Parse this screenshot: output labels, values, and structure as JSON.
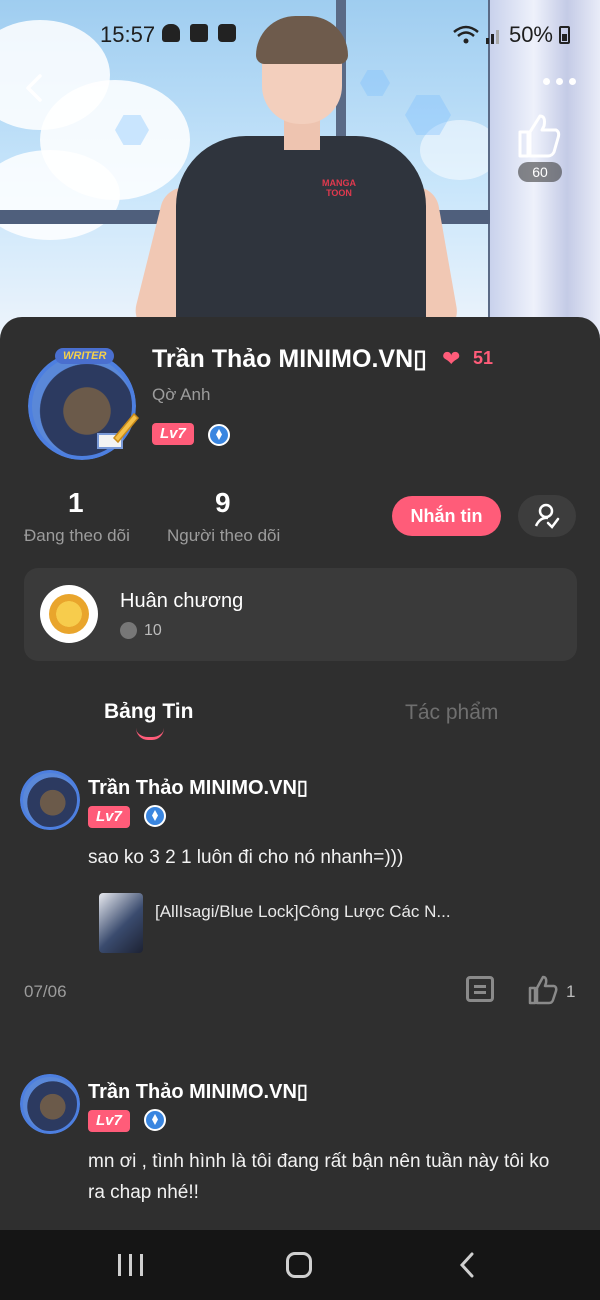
{
  "status_bar": {
    "time": "15:57",
    "battery": "50%"
  },
  "header": {
    "like_count": "60"
  },
  "banner_art": {
    "shirt_logo": "MANGA TOON"
  },
  "profile": {
    "avatar_tag": "WRITER",
    "name": "Trần Thảo MINIMO.VN▯",
    "heart_count": "51",
    "subname": "Qờ Anh",
    "level": "Lv7",
    "stats": [
      {
        "value": "1",
        "label": "Đang theo dõi"
      },
      {
        "value": "9",
        "label": "Người theo dõi"
      }
    ],
    "message_button": "Nhắn tin"
  },
  "medal": {
    "title": "Huân chương",
    "count": "10"
  },
  "tabs": [
    {
      "label": "Bảng Tin",
      "active": true
    },
    {
      "label": "Tác phẩm",
      "active": false
    }
  ],
  "posts": [
    {
      "author": "Trần Thảo MINIMO.VN▯",
      "level": "Lv7",
      "text": "sao ko 3 2 1 luôn đi cho nó nhanh=)))",
      "link_title": "[AllIsagi/Blue Lock]Công Lược Các N...",
      "date": "07/06",
      "likes": "1"
    },
    {
      "author": "Trần Thảo MINIMO.VN▯",
      "level": "Lv7",
      "text": "mn ơi , tình hình là tôi đang rất bận nên tuần này tôi ko ra chap nhé!!"
    }
  ],
  "colors": {
    "accent": "#ff5c79",
    "background": "#2f2f2f",
    "card": "#3a3a3a"
  }
}
